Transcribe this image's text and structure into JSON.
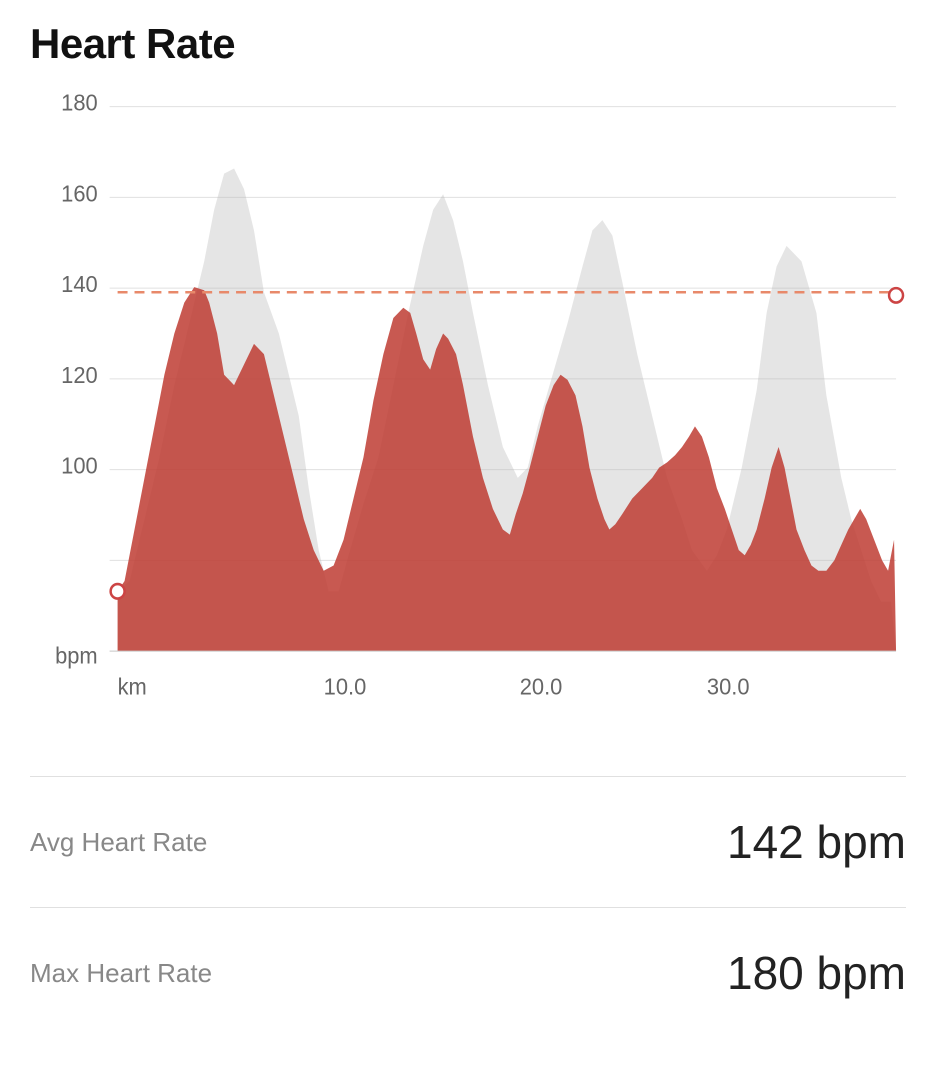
{
  "page": {
    "title": "Heart Rate",
    "chart": {
      "y_labels": [
        "180",
        "160",
        "140",
        "120",
        "100"
      ],
      "y_unit": "bpm",
      "x_labels": [
        "km",
        "10.0",
        "20.0",
        "30.0"
      ],
      "avg_line_value": 142,
      "y_min": 70,
      "y_max": 200
    },
    "stats": [
      {
        "label": "Avg Heart Rate",
        "value": "142 bpm"
      },
      {
        "label": "Max Heart Rate",
        "value": "180 bpm"
      }
    ]
  }
}
